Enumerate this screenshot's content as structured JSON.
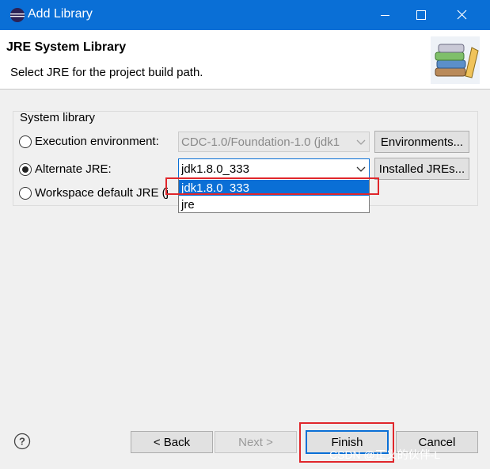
{
  "window": {
    "title": "Add Library",
    "icon": "eclipse-icon",
    "controls": [
      "minimize-icon",
      "maximize-icon",
      "close-icon"
    ]
  },
  "header": {
    "title": "JRE System Library",
    "subtitle": "Select JRE for the project build path.",
    "image": "library-books-icon"
  },
  "system_library": {
    "label": "System library",
    "options": [
      {
        "label": "Execution environment:",
        "selected": false,
        "combo_value": "CDC-1.0/Foundation-1.0 (jdk1",
        "combo_enabled": false,
        "button": "Environments..."
      },
      {
        "label": "Alternate JRE:",
        "selected": true,
        "combo_value": "jdk1.8.0_333",
        "combo_enabled": true,
        "button": "Installed JREs..."
      },
      {
        "label": "Workspace default JRE (j",
        "selected": false
      }
    ],
    "dropdown_items": [
      "jdk1.8.0_333",
      "jre"
    ],
    "dropdown_selected": "jdk1.8.0_333"
  },
  "footer": {
    "help_icon": "help-icon",
    "back": "< Back",
    "next": "Next >",
    "finish": "Finish",
    "cancel": "Cancel"
  },
  "watermark": "CSDN @正义的伙伴-L",
  "colors": {
    "accent": "#0a6fd6",
    "highlight": "#e0262b",
    "background": "#f0f0f0"
  }
}
